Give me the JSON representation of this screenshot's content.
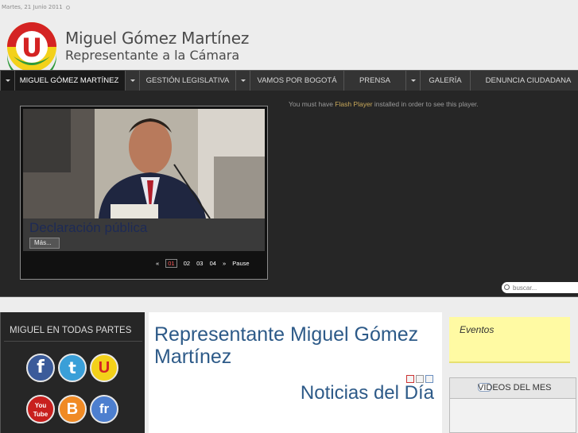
{
  "date": "Martes, 21 Junio 2011",
  "site": {
    "title": "Miguel Gómez Martínez",
    "subtitle": "Representante a la Cámara",
    "logo_letter": "U"
  },
  "nav": {
    "items": [
      {
        "label": "MIGUEL GÓMEZ MARTÍNEZ"
      },
      {
        "label": "GESTIÓN LEGISLATIVA"
      },
      {
        "label": "VAMOS POR BOGOTÁ"
      },
      {
        "label": "PRENSA"
      },
      {
        "label": "GALERÍA"
      },
      {
        "label": "DENUNCIA CIUDADANA"
      }
    ]
  },
  "slider": {
    "caption": "Declaración pública",
    "more_label": "Más...",
    "prev": "«",
    "pages": [
      "01",
      "02",
      "03",
      "04"
    ],
    "next": "»",
    "pause": "Pause",
    "current_page": 1
  },
  "flash": {
    "before": "You must have ",
    "link": "Flash Player",
    "after": " installed in order to see this player."
  },
  "search": {
    "placeholder": "buscar..."
  },
  "left": {
    "title": "MIGUEL EN TODAS PARTES",
    "social": [
      {
        "icon": "facebook-icon",
        "glyph": "f"
      },
      {
        "icon": "twitter-icon",
        "glyph": "t"
      },
      {
        "icon": "party-u-icon",
        "glyph": "U"
      },
      {
        "icon": "youtube-icon",
        "glyph": "You Tube"
      },
      {
        "icon": "blogger-icon",
        "glyph": "B"
      },
      {
        "icon": "friendfeed-icon",
        "glyph": "fr"
      }
    ]
  },
  "main": {
    "title": "Representante Miguel Gómez Martínez",
    "news_title": "Noticias del Día"
  },
  "right": {
    "events_label": "Eventos",
    "videos_label": "VIDEOS DEL MES"
  },
  "colors": {
    "nav_bg": "#343434",
    "heading_blue": "#2d5a88",
    "note_yellow": "#fffaa3",
    "logo_red": "#d42323",
    "logo_yellow": "#f3d11a",
    "logo_green": "#2f9a3a"
  }
}
